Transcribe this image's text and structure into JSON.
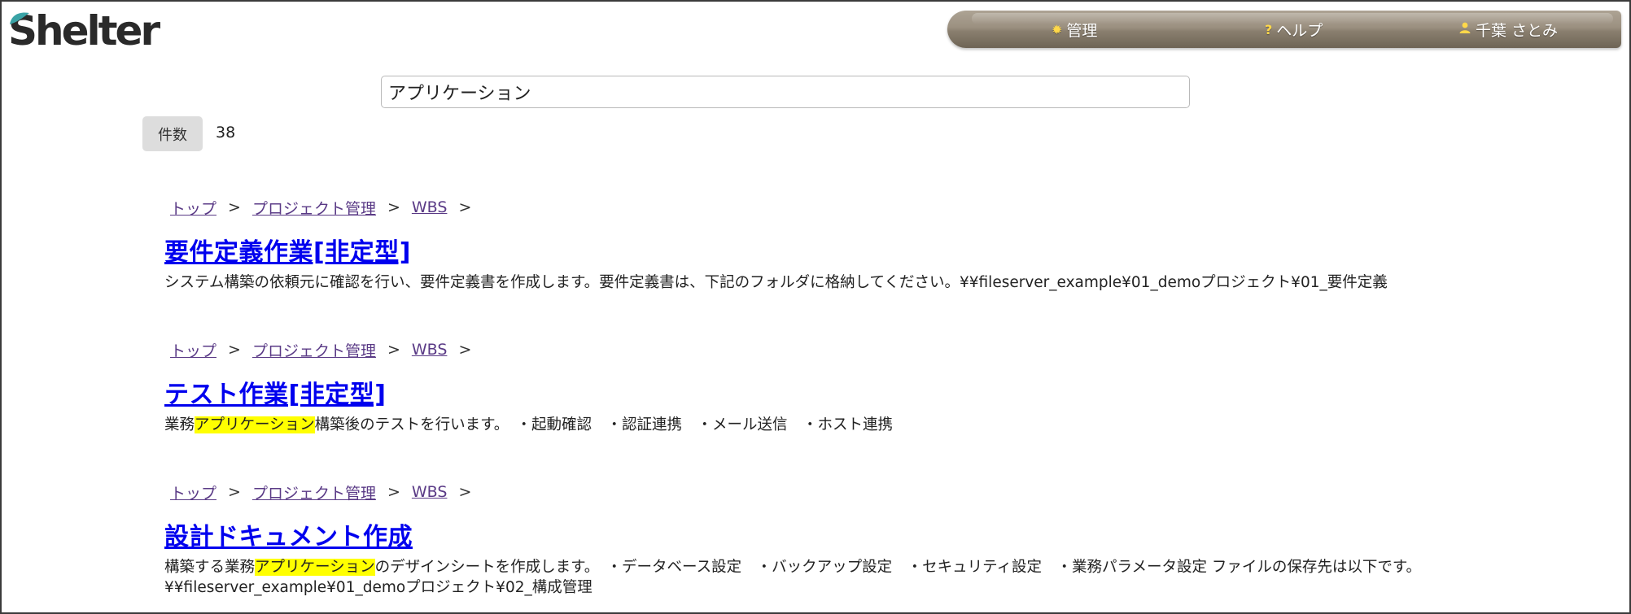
{
  "app": {
    "logo_text": "Shelter",
    "brand_accent": "#3aa3a6"
  },
  "nav": {
    "admin_label": "管理",
    "help_label": "ヘルプ",
    "user_label": "千葉 さとみ"
  },
  "search": {
    "value": "アプリケーション"
  },
  "count": {
    "label": "件数",
    "value": "38"
  },
  "results": [
    {
      "breadcrumb": [
        "トップ",
        "プロジェクト管理",
        "WBS"
      ],
      "title": "要件定義作業[非定型]",
      "desc_parts": [
        "システム構築の依頼元に確認を行い、要件定義書を作成します。要件定義書は、下記のフォルダに格納してください。¥¥fileserver_example¥01_demoプロジェクト¥01_要件定義"
      ]
    },
    {
      "breadcrumb": [
        "トップ",
        "プロジェクト管理",
        "WBS"
      ],
      "title": "テスト作業[非定型]",
      "desc_parts": [
        "業務",
        "アプリケーション",
        "構築後のテストを行います。　・起動確認　・認証連携　・メール送信　・ホスト連携"
      ]
    },
    {
      "breadcrumb": [
        "トップ",
        "プロジェクト管理",
        "WBS"
      ],
      "title": "設計ドキュメント作成",
      "desc_parts": [
        "構築する業務",
        "アプリケーション",
        "のデザインシートを作成します。　・データベース設定　・バックアップ設定　・セキュリティ設定　・業務パラメータ設定 ファイルの保存先は以下です。\n¥¥fileserver_example¥01_demoプロジェクト¥02_構成管理"
      ]
    }
  ],
  "separator": ">",
  "highlight_color": "#ffff00"
}
